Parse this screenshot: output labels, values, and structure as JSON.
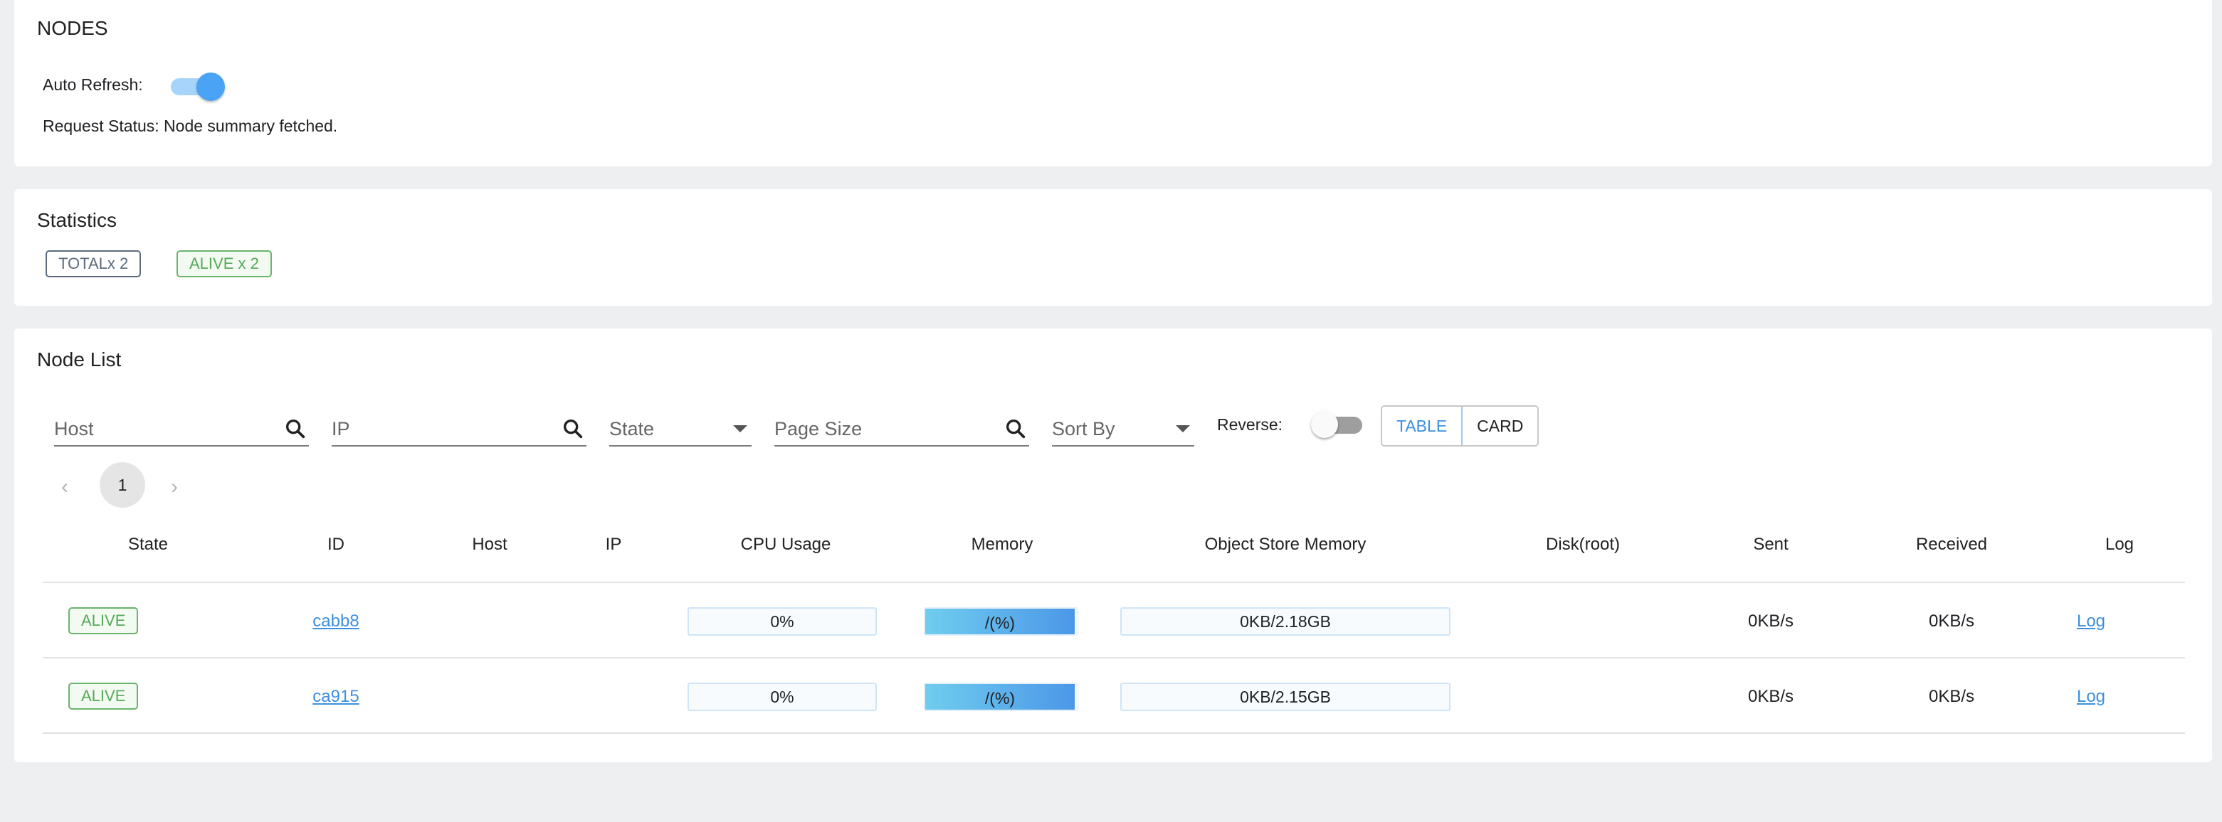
{
  "nodes_card": {
    "title": "NODES",
    "auto_refresh_label": "Auto Refresh:",
    "auto_refresh_on": true,
    "request_status": "Request Status: Node summary fetched."
  },
  "stats_card": {
    "title": "Statistics",
    "total_chip": "TOTALx 2",
    "alive_chip": "ALIVE x 2"
  },
  "list_card": {
    "title": "Node List",
    "filters": {
      "host_placeholder": "Host",
      "ip_placeholder": "IP",
      "state_placeholder": "State",
      "page_size_placeholder": "Page Size",
      "sort_by_placeholder": "Sort By",
      "reverse_label": "Reverse:",
      "reverse_on": false
    },
    "view_toggle": {
      "table": "TABLE",
      "card": "CARD",
      "selected": "TABLE"
    },
    "pagination": {
      "prev": "‹",
      "page": "1",
      "next": "›"
    },
    "columns": [
      "State",
      "ID",
      "Host",
      "IP",
      "CPU Usage",
      "Memory",
      "Object Store Memory",
      "Disk(root)",
      "Sent",
      "Received",
      "Log"
    ],
    "rows": [
      {
        "state": "ALIVE",
        "id": "cabb8",
        "host": "",
        "ip": "",
        "cpu": "0%",
        "memory": "/(%)",
        "object_store": "0KB/2.18GB",
        "disk": "",
        "sent": "0KB/s",
        "received": "0KB/s",
        "log": "Log"
      },
      {
        "state": "ALIVE",
        "id": "ca915",
        "host": "",
        "ip": "",
        "cpu": "0%",
        "memory": "/(%)",
        "object_store": "0KB/2.15GB",
        "disk": "",
        "sent": "0KB/s",
        "received": "0KB/s",
        "log": "Log"
      }
    ]
  },
  "colors": {
    "accent": "#4aa3f4",
    "alive_green": "#57a85a",
    "page_background": "#eeeff1"
  }
}
